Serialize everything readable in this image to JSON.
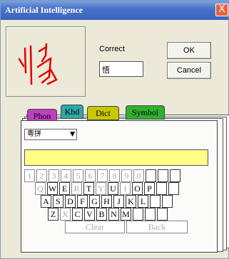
{
  "window": {
    "title": "Artificial Intelligence",
    "close_label": "X"
  },
  "ink": {
    "character": "悄"
  },
  "recognition": {
    "correct_label": "Correct",
    "correct_value": "悟"
  },
  "buttons": {
    "ok": "OK",
    "cancel": "Cancel"
  },
  "tabs": [
    {
      "label": "Phon",
      "color": "#c040c0"
    },
    {
      "label": "Kbd",
      "color": "#30a8a8"
    },
    {
      "label": "Dict",
      "color": "#c8c800"
    },
    {
      "label": "Symbol",
      "color": "#30b030"
    }
  ],
  "input_method": {
    "selected": "粵拼",
    "arrow": "▼"
  },
  "keyboard": {
    "row1": [
      "1",
      "2",
      "3",
      "4",
      "5",
      "6",
      "7",
      "8",
      "9",
      "0",
      "",
      "",
      ""
    ],
    "row2": [
      "Q",
      "W",
      "E",
      "R",
      "T",
      "Y",
      "U",
      "I",
      "O",
      "P",
      "",
      ""
    ],
    "row3": [
      "A",
      "S",
      "D",
      "F",
      "G",
      "H",
      "J",
      "K",
      "L",
      "",
      ""
    ],
    "row4": [
      "Z",
      "X",
      "C",
      "V",
      "B",
      "N",
      "M",
      "",
      "",
      ""
    ],
    "clear": "Clear",
    "back": "Back"
  },
  "colors": {
    "highlight_bar": "#ffff88",
    "titlebar": "#3a63bd"
  }
}
